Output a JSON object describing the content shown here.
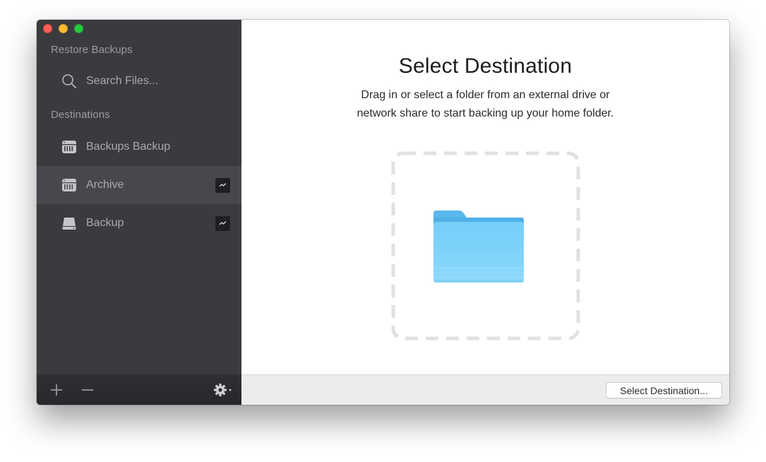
{
  "window": {
    "traffic_lights": [
      "close",
      "minimize",
      "zoom"
    ]
  },
  "sidebar": {
    "restore_section_title": "Restore Backups",
    "search": {
      "icon": "search-icon",
      "label": "Search Files..."
    },
    "destinations_section_title": "Destinations",
    "destinations": [
      {
        "label": "Backups Backup",
        "icon": "time-capsule-icon",
        "ejectable": false,
        "selected": false
      },
      {
        "label": "Archive",
        "icon": "time-capsule-icon",
        "ejectable": true,
        "selected": true
      },
      {
        "label": "Backup",
        "icon": "external-drive-icon",
        "ejectable": true,
        "selected": false
      }
    ],
    "footer": {
      "add_icon": "plus-icon",
      "remove_icon": "minus-icon",
      "settings_icon": "gear-icon"
    }
  },
  "main": {
    "title": "Select Destination",
    "description_line1": "Drag in or select a folder from an external drive or",
    "description_line2": "network share to start backing up your home folder.",
    "drop_zone_icon": "folder-icon",
    "select_button_label": "Select Destination..."
  },
  "colors": {
    "sidebar_bg": "#3a3b3f",
    "sidebar_selected": "#47484d",
    "folder_blue": "#6cc9f7",
    "close": "#fc5f57",
    "minimize": "#fdbc2e",
    "zoom": "#28c840"
  }
}
